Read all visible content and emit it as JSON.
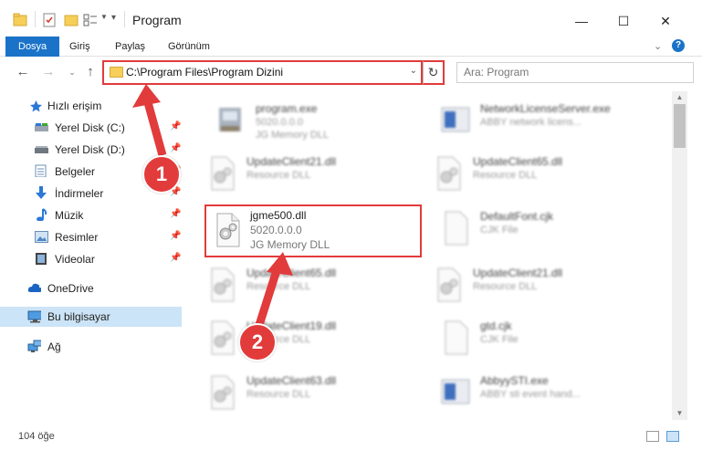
{
  "window": {
    "title": "Program",
    "controls": {
      "minimize": "—",
      "maximize": "☐",
      "close": "✕"
    }
  },
  "ribbon": {
    "tabs": [
      "Dosya",
      "Giriş",
      "Paylaş",
      "Görünüm"
    ],
    "active_tab": "Dosya"
  },
  "address": {
    "path": "C:\\Program Files\\Program Dizini",
    "search_placeholder": "Ara: Program"
  },
  "sidebar": {
    "items": [
      {
        "label": "Hızlı erişim",
        "icon": "star-icon"
      },
      {
        "label": "Yerel Disk (C:)",
        "icon": "drive-icon"
      },
      {
        "label": "Yerel Disk (D:)",
        "icon": "drive-icon"
      },
      {
        "label": "Belgeler",
        "icon": "documents-icon"
      },
      {
        "label": "İndirmeler",
        "icon": "download-icon"
      },
      {
        "label": "Müzik",
        "icon": "music-icon"
      },
      {
        "label": "Resimler",
        "icon": "pictures-icon"
      },
      {
        "label": "Videolar",
        "icon": "videos-icon"
      },
      {
        "label": "OneDrive",
        "icon": "cloud-icon"
      },
      {
        "label": "Bu bilgisayar",
        "icon": "computer-icon"
      },
      {
        "label": "Ağ",
        "icon": "network-icon"
      }
    ]
  },
  "files": [
    {
      "name": "program.exe",
      "line2": "5020.0.0.0",
      "line3": "JG Memory DLL"
    },
    {
      "name": "NetworkLicenseServer.exe",
      "line2": "ABBY network licens...",
      "line3": ""
    },
    {
      "name": "UpdateClient21.dll",
      "line2": "Resource DLL",
      "line3": ""
    },
    {
      "name": "UpdateClient65.dll",
      "line2": "Resource DLL",
      "line3": ""
    },
    {
      "name": "jgme500.dll",
      "line2": "5020.0.0.0",
      "line3": "JG Memory DLL"
    },
    {
      "name": "DefaultFont.cjk",
      "line2": "CJK File",
      "line3": ""
    },
    {
      "name": "UpdateClient65.dll",
      "line2": "Resource DLL",
      "line3": ""
    },
    {
      "name": "UpdateClient21.dll",
      "line2": "Resource DLL",
      "line3": ""
    },
    {
      "name": "UpdateClient19.dll",
      "line2": "Resource DLL",
      "line3": ""
    },
    {
      "name": "gtd.cjk",
      "line2": "CJK File",
      "line3": ""
    },
    {
      "name": "UpdateClient63.dll",
      "line2": "Resource DLL",
      "line3": ""
    },
    {
      "name": "AbbyySTI.exe",
      "line2": "ABBY sti event hand...",
      "line3": ""
    }
  ],
  "status": {
    "item_count": "104 öğe"
  },
  "annotations": {
    "step1": "1",
    "step2": "2"
  },
  "colors": {
    "accent": "#1a73c8",
    "highlight": "#e23b3b",
    "selected": "#cce4f7"
  }
}
